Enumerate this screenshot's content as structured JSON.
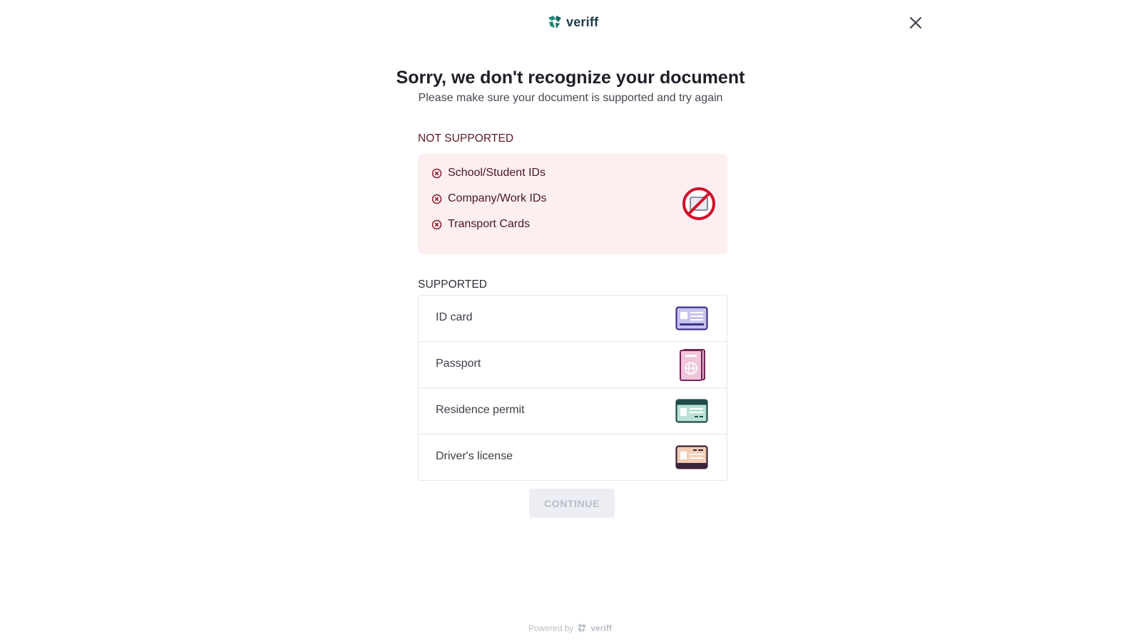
{
  "header": {
    "brand": "veriff",
    "close_icon": "close-icon"
  },
  "main": {
    "title": "Sorry, we don't recognize your document",
    "subtitle": "Please make sure your document is supported and try again"
  },
  "not_supported": {
    "label": "NOT SUPPORTED",
    "items": [
      {
        "label": "School/Student IDs",
        "icon": "x-circle-icon"
      },
      {
        "label": "Company/Work IDs",
        "icon": "x-circle-icon"
      },
      {
        "label": "Transport Cards",
        "icon": "x-circle-icon"
      }
    ],
    "icon": "prohibited-card-icon",
    "colors": {
      "background": "#fdeff0",
      "accent": "#d0112b"
    }
  },
  "supported": {
    "label": "SUPPORTED",
    "items": [
      {
        "label": "ID card",
        "icon": "id-card-icon"
      },
      {
        "label": "Passport",
        "icon": "passport-icon"
      },
      {
        "label": "Residence permit",
        "icon": "residence-permit-icon"
      },
      {
        "label": "Driver's license",
        "icon": "drivers-license-icon"
      }
    ]
  },
  "actions": {
    "continue_label": "CONTINUE"
  },
  "footer": {
    "powered_by": "Powered by",
    "brand": "veriff"
  }
}
